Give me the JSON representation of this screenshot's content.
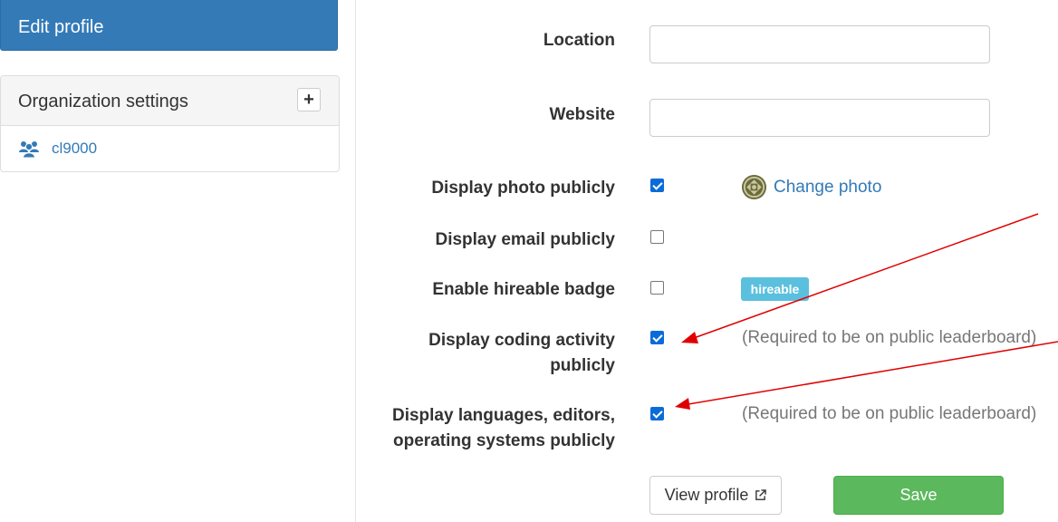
{
  "sidebar": {
    "active_item": "Edit profile",
    "org_panel": {
      "title": "Organization settings",
      "add_icon": "plus-icon",
      "items": [
        {
          "label": "cl9000",
          "icon": "users-icon"
        }
      ]
    }
  },
  "form": {
    "location": {
      "label": "Location",
      "value": "",
      "placeholder": ""
    },
    "website": {
      "label": "Website",
      "value": "",
      "placeholder": ""
    },
    "display_photo": {
      "label": "Display photo publicly",
      "checked": true,
      "link": "Change photo"
    },
    "display_email": {
      "label": "Display email publicly",
      "checked": false
    },
    "hireable": {
      "label": "Enable hireable badge",
      "checked": false,
      "badge": "hireable"
    },
    "coding_activity": {
      "label_line1": "Display coding activity",
      "label_line2": "publicly",
      "checked": true,
      "help": "(Required to be on public leaderboard)"
    },
    "languages": {
      "label_line1": "Display languages, editors,",
      "label_line2": "operating systems publicly",
      "checked": true,
      "help": "(Required to be on public leaderboard)"
    }
  },
  "buttons": {
    "view_profile": "View profile",
    "save": "Save"
  },
  "colors": {
    "primary": "#337ab7",
    "success": "#5cb85c",
    "info": "#5bc0de",
    "checkbox": "#0b6cd8",
    "annotation_arrow": "#e00000"
  }
}
